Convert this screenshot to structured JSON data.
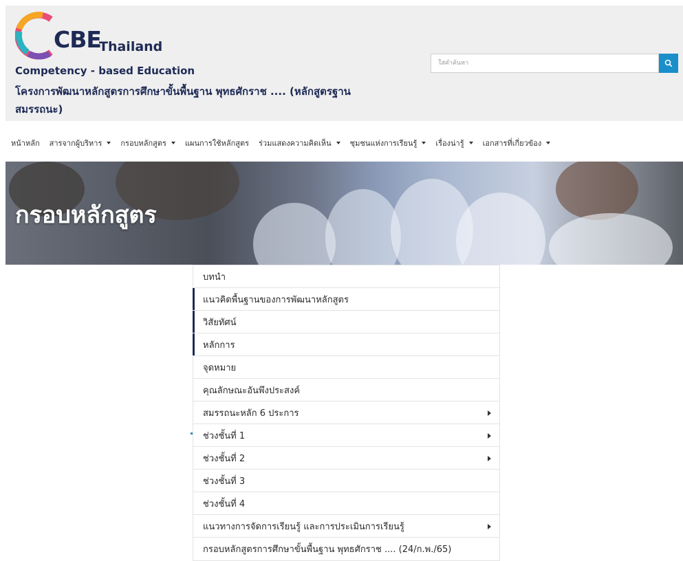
{
  "brand": {
    "logo_text": "CBE",
    "logo_subtext": "Thailand",
    "tagline": "Competency - based Education",
    "project_title": "โครงการพัฒนาหลักสูตรการศึกษาขั้นพื้นฐาน พุทธศักราช .... (หลักสูตรฐานสมรรถนะ)",
    "colors": {
      "primary": "#1e2a55",
      "accent": "#1a8fc9",
      "header_bg": "#efefef"
    }
  },
  "search": {
    "placeholder": "ใส่คำค้นหา",
    "icon": "search-icon"
  },
  "nav": {
    "items": [
      {
        "label": "หน้าหลัก",
        "has_dropdown": false
      },
      {
        "label": "สารจากผู้บริหาร",
        "has_dropdown": true
      },
      {
        "label": "กรอบหลักสูตร",
        "has_dropdown": true
      },
      {
        "label": "แผนการใช้หลักสูตร",
        "has_dropdown": false
      },
      {
        "label": "ร่วมแสดงความคิดเห็น",
        "has_dropdown": true
      },
      {
        "label": "ชุมชนแห่งการเรียนรู้",
        "has_dropdown": true
      },
      {
        "label": "เรื่องน่ารู้",
        "has_dropdown": true
      },
      {
        "label": "เอกสารที่เกี่ยวข้อง",
        "has_dropdown": true
      }
    ]
  },
  "banner": {
    "title": "กรอบหลักสูตร"
  },
  "menu": {
    "items": [
      {
        "label": "บทนำ",
        "has_submenu": false
      },
      {
        "label": "แนวคิดพื้นฐานของการพัฒนาหลักสูตร",
        "has_submenu": false
      },
      {
        "label": "วิสัยทัศน์",
        "has_submenu": false
      },
      {
        "label": "หลักการ",
        "has_submenu": false
      },
      {
        "label": "จุดหมาย",
        "has_submenu": false
      },
      {
        "label": "คุณลักษณะอันพึงประสงค์",
        "has_submenu": false
      },
      {
        "label": "สมรรถนะหลัก 6 ประการ",
        "has_submenu": true
      },
      {
        "label": "ช่วงชั้นที่ 1",
        "has_submenu": true
      },
      {
        "label": "ช่วงชั้นที่ 2",
        "has_submenu": true
      },
      {
        "label": "ช่วงชั้นที่ 3",
        "has_submenu": false
      },
      {
        "label": "ช่วงชั้นที่ 4",
        "has_submenu": false
      },
      {
        "label": "แนวทางการจัดการเรียนรู้ และการประเมินการเรียนรู้",
        "has_submenu": true
      },
      {
        "label": "กรอบหลักสูตรการศึกษาขั้นพื้นฐาน พุทธศักราช .... (24/ก.พ./65)",
        "has_submenu": false
      }
    ]
  }
}
